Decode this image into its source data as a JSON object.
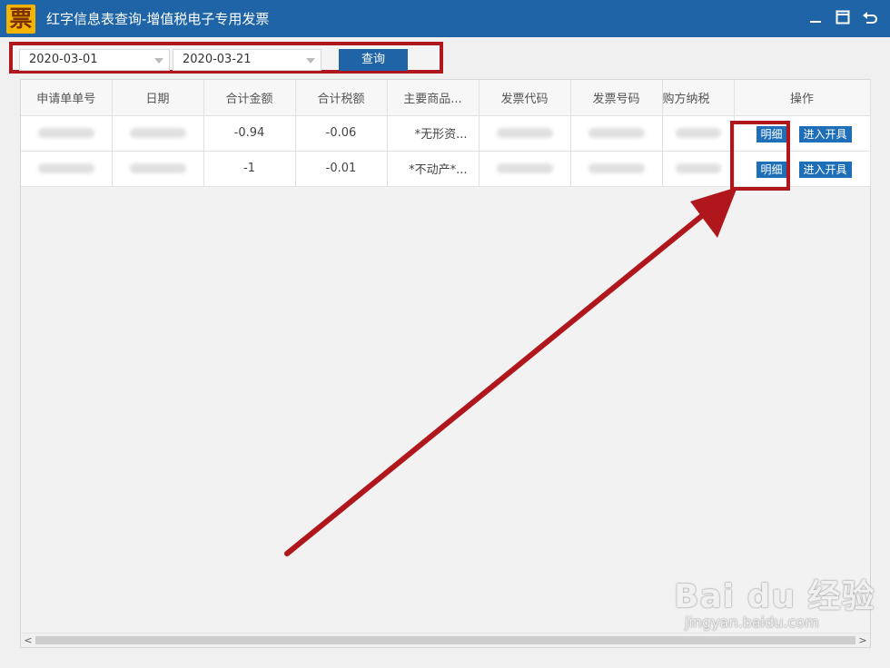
{
  "window": {
    "app_icon_glyph": "票",
    "title": "红字信息表查询-增值税电子专用发票",
    "controls": [
      "minimize-icon",
      "maximize-icon",
      "back-icon"
    ]
  },
  "toolbar": {
    "start_date": "2020-03-01",
    "end_date": "2020-03-21",
    "query_label": "查询"
  },
  "table": {
    "columns": [
      "申请单单号",
      "日期",
      "合计金额",
      "合计税额",
      "主要商品...",
      "发票代码",
      "发票号码",
      "购方纳税",
      "操作"
    ],
    "rows": [
      {
        "total_amount": "-0.94",
        "total_tax": "-0.06",
        "main_goods": "*无形资...",
        "detail_label": "明细",
        "open_label": "进入开具"
      },
      {
        "total_amount": "-1",
        "total_tax": "-0.01",
        "main_goods": "*不动产*...",
        "detail_label": "明细",
        "open_label": "进入开具"
      }
    ]
  },
  "scrollbar": {
    "left_arrow": "<",
    "right_arrow": ">"
  },
  "watermark": {
    "brand": "Bai du 经验",
    "url": "jingyan.baidu.com"
  },
  "colors": {
    "title_bar": "#1e64a6",
    "button_blue": "#1e6fb8",
    "annotation_red": "#b0171d"
  }
}
